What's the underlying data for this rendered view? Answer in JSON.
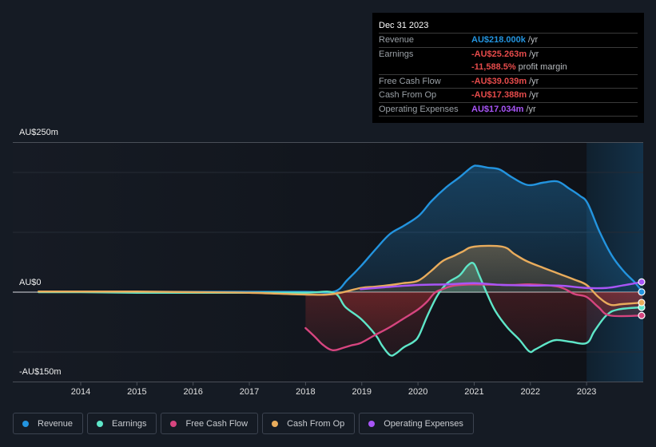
{
  "tooltip": {
    "date": "Dec 31 2023",
    "rows": [
      {
        "label": "Revenue",
        "value": "AU$218.000k",
        "unit": "/yr",
        "color": "#2394df"
      },
      {
        "label": "Earnings",
        "value": "-AU$25.263m",
        "unit": "/yr",
        "color": "#e64b4b"
      },
      {
        "label": "",
        "value": "-11,588.5%",
        "unit": "profit margin",
        "color": "#e64b4b"
      },
      {
        "label": "Free Cash Flow",
        "value": "-AU$39.039m",
        "unit": "/yr",
        "color": "#e64b4b"
      },
      {
        "label": "Cash From Op",
        "value": "-AU$17.388m",
        "unit": "/yr",
        "color": "#e64b4b"
      },
      {
        "label": "Operating Expenses",
        "value": "AU$17.034m",
        "unit": "/yr",
        "color": "#a855f7"
      }
    ]
  },
  "chart_data": {
    "type": "line",
    "title": "",
    "xlabel": "",
    "ylabel": "",
    "x_ticks": [
      "2014",
      "2015",
      "2016",
      "2017",
      "2018",
      "2019",
      "2020",
      "2021",
      "2022",
      "2023"
    ],
    "x_tick_values": [
      2014,
      2015,
      2016,
      2017,
      2018,
      2019,
      2020,
      2021,
      2022,
      2023
    ],
    "xlim": [
      2013.0,
      2024.0
    ],
    "y_ticks": [
      "AU$250m",
      "AU$0",
      "-AU$150m"
    ],
    "y_tick_values": [
      250,
      0,
      -150
    ],
    "ylim": [
      -150,
      250
    ],
    "y_unit": "AU$m",
    "grid": true,
    "gridlines": [
      250,
      200,
      100,
      0,
      -100,
      -150
    ],
    "highlight_range": [
      2023.0,
      2024.0
    ],
    "legend_position": "bottom",
    "series": [
      {
        "name": "Revenue",
        "color": "#2394df",
        "fill": true,
        "x": [
          2013.25,
          2014,
          2015,
          2016,
          2017,
          2018,
          2018.51,
          2018.75,
          2018.99,
          2019.25,
          2019.5,
          2019.75,
          2020.02,
          2020.24,
          2020.5,
          2020.74,
          2020.96,
          2021.06,
          2021.24,
          2021.45,
          2021.67,
          2021.95,
          2022.23,
          2022.48,
          2022.69,
          2022.88,
          2023.02,
          2023.23,
          2023.45,
          2023.66,
          2023.87,
          2023.99
        ],
        "values": [
          0.5,
          0.5,
          0.5,
          0.5,
          0.5,
          0.5,
          1,
          21,
          44,
          72,
          97,
          111,
          128,
          152,
          175,
          192,
          209,
          211,
          208,
          205,
          192,
          179,
          183,
          185,
          173,
          161,
          148,
          101,
          61,
          35,
          15,
          0.218
        ]
      },
      {
        "name": "Earnings",
        "color": "#5ee6c8",
        "fill": true,
        "x": [
          2013.25,
          2014,
          2015,
          2016,
          2017,
          2018,
          2018.5,
          2018.71,
          2018.99,
          2019.25,
          2019.36,
          2019.5,
          2019.6,
          2019.75,
          2019.92,
          2020.02,
          2020.17,
          2020.35,
          2020.52,
          2020.74,
          2020.88,
          2020.99,
          2021.09,
          2021.24,
          2021.38,
          2021.59,
          2021.8,
          2021.98,
          2022.08,
          2022.3,
          2022.46,
          2022.72,
          2023.0,
          2023.14,
          2023.35,
          2023.56,
          2023.99
        ],
        "values": [
          0,
          0,
          -1,
          -1,
          -1,
          -1,
          -1,
          -25,
          -45,
          -72,
          -89,
          -105,
          -103,
          -92,
          -83,
          -72,
          -39,
          -5,
          15,
          28,
          44,
          48,
          28,
          -5,
          -32,
          -59,
          -79,
          -99,
          -96,
          -85,
          -80,
          -83,
          -85,
          -65,
          -39,
          -29,
          -25.263
        ]
      },
      {
        "name": "Free Cash Flow",
        "color": "#d6457f",
        "fill": true,
        "x": [
          2018.0,
          2018.17,
          2018.31,
          2018.48,
          2018.67,
          2018.81,
          2018.98,
          2019.23,
          2019.49,
          2019.73,
          2020.0,
          2020.16,
          2020.3,
          2020.44,
          2020.65,
          2021.0,
          2021.64,
          2022.0,
          2022.5,
          2022.78,
          2023.0,
          2023.21,
          2023.42,
          2023.99
        ],
        "values": [
          -60,
          -75,
          -88,
          -97,
          -93,
          -89,
          -85,
          -72,
          -59,
          -45,
          -29,
          -16,
          -1,
          5,
          11,
          13,
          12,
          13,
          9,
          -3,
          -8,
          -25,
          -39,
          -39.039
        ]
      },
      {
        "name": "Cash From Op",
        "color": "#e9ac5c",
        "fill": true,
        "x": [
          2013.25,
          2014,
          2015,
          2016,
          2017,
          2018,
          2018.5,
          2018.98,
          2019.23,
          2019.52,
          2019.73,
          2020.0,
          2020.23,
          2020.44,
          2020.65,
          2020.8,
          2021.0,
          2021.5,
          2021.71,
          2021.93,
          2022.22,
          2022.5,
          2022.78,
          2023.0,
          2023.21,
          2023.42,
          2023.63,
          2023.99
        ],
        "values": [
          1,
          1,
          1,
          0,
          -1,
          -4,
          -3,
          7,
          9,
          12,
          15,
          19,
          35,
          52,
          61,
          68,
          76,
          76,
          64,
          52,
          41,
          31,
          21,
          12,
          -8,
          -21,
          -20,
          -17.388
        ]
      },
      {
        "name": "Operating Expenses",
        "color": "#a855f7",
        "fill": false,
        "x": [
          2018.98,
          2019.38,
          2020.0,
          2020.5,
          2021.0,
          2021.5,
          2022.0,
          2022.5,
          2023.0,
          2023.35,
          2023.63,
          2023.99
        ],
        "values": [
          5,
          8,
          12,
          13,
          15,
          12,
          11,
          11,
          7,
          7,
          11,
          17.034
        ]
      }
    ]
  },
  "legend": [
    {
      "label": "Revenue",
      "color": "#2394df"
    },
    {
      "label": "Earnings",
      "color": "#5ee6c8"
    },
    {
      "label": "Free Cash Flow",
      "color": "#d6457f"
    },
    {
      "label": "Cash From Op",
      "color": "#e9ac5c"
    },
    {
      "label": "Operating Expenses",
      "color": "#a855f7"
    }
  ]
}
